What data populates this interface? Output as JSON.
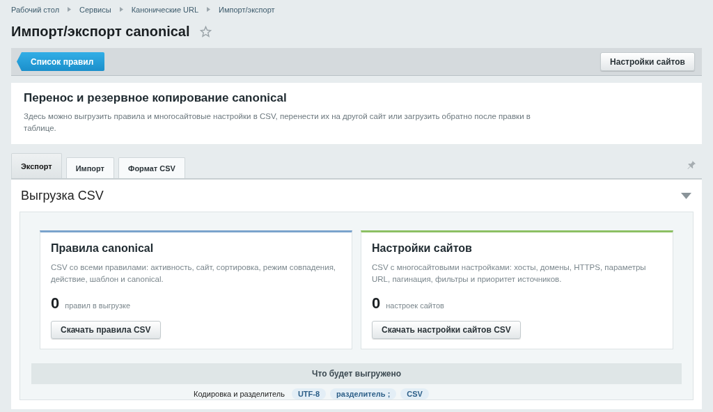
{
  "breadcrumbs": [
    "Рабочий стол",
    "Сервисы",
    "Канонические URL",
    "Импорт/экспорт"
  ],
  "title": "Импорт/экспорт canonical",
  "favorite": false,
  "toolbar": {
    "back_button": "Список правил",
    "right_button": "Настройки сайтов"
  },
  "intro": {
    "heading": "Перенос и резервное копирование canonical",
    "text": "Здесь можно выгрузить правила и многосайтовые настройки в CSV, перенести их на другой сайт или загрузить обратно после правки в таблице."
  },
  "tabs": [
    {
      "label": "Экспорт",
      "selected": true
    },
    {
      "label": "Импорт",
      "selected": false
    },
    {
      "label": "Формат CSV",
      "selected": false
    }
  ],
  "section": {
    "title": "Выгрузка CSV",
    "expanded": true,
    "cards": [
      {
        "title": "Правила canonical",
        "color": "#7aa3cc",
        "text": "CSV со всеми правилами: активность, сайт, сортировка, режим совпадения, действие, шаблон и canonical.",
        "count": "0",
        "count_label": "правил в выгрузке",
        "button": "Скачать правила CSV"
      },
      {
        "title": "Настройки сайтов",
        "color": "#8cc063",
        "text": "CSV с многосайтовыми настройками: хосты, домены, HTTPS, параметры URL, пагинация, фильтры и приоритет источников.",
        "count": "0",
        "count_label": "настроек сайтов",
        "button": "Скачать настройки сайтов CSV"
      }
    ],
    "summary_heading": "Что будет выгружено",
    "summary_row": {
      "label": "Кодировка и разделитель",
      "tags": [
        "UTF-8",
        "разделитель ;",
        "CSV"
      ]
    }
  }
}
